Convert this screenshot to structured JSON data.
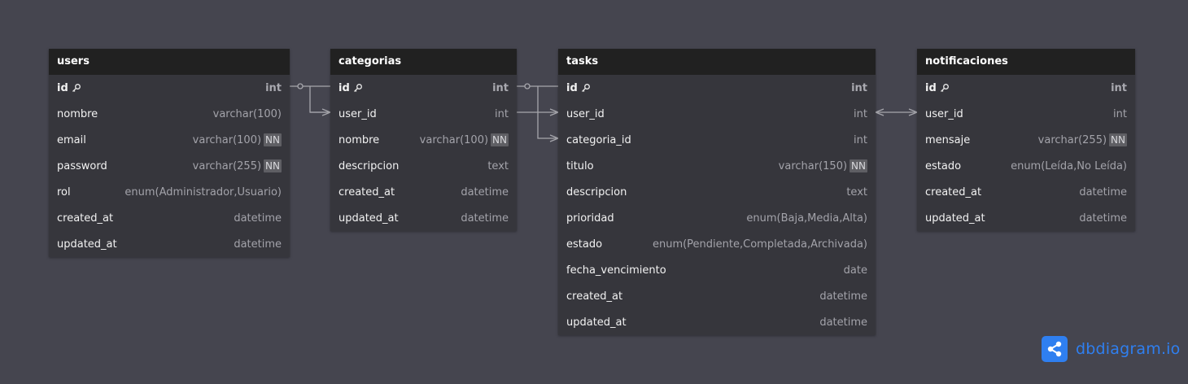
{
  "colors": {
    "background": "#45454f",
    "table_header": "#212121",
    "table_body": "#36363c",
    "connector": "#a6a6ac",
    "brand": "#2f7ff0"
  },
  "tables": [
    {
      "name": "users",
      "fields": [
        {
          "name": "id",
          "type": "int",
          "pk": true,
          "nn": false
        },
        {
          "name": "nombre",
          "type": "varchar(100)",
          "pk": false,
          "nn": false
        },
        {
          "name": "email",
          "type": "varchar(100)",
          "pk": false,
          "nn": true
        },
        {
          "name": "password",
          "type": "varchar(255)",
          "pk": false,
          "nn": true
        },
        {
          "name": "rol",
          "type": "enum(Administrador,Usuario)",
          "pk": false,
          "nn": false
        },
        {
          "name": "created_at",
          "type": "datetime",
          "pk": false,
          "nn": false
        },
        {
          "name": "updated_at",
          "type": "datetime",
          "pk": false,
          "nn": false
        }
      ]
    },
    {
      "name": "categorias",
      "fields": [
        {
          "name": "id",
          "type": "int",
          "pk": true,
          "nn": false
        },
        {
          "name": "user_id",
          "type": "int",
          "pk": false,
          "nn": false
        },
        {
          "name": "nombre",
          "type": "varchar(100)",
          "pk": false,
          "nn": true
        },
        {
          "name": "descripcion",
          "type": "text",
          "pk": false,
          "nn": false
        },
        {
          "name": "created_at",
          "type": "datetime",
          "pk": false,
          "nn": false
        },
        {
          "name": "updated_at",
          "type": "datetime",
          "pk": false,
          "nn": false
        }
      ]
    },
    {
      "name": "tasks",
      "fields": [
        {
          "name": "id",
          "type": "int",
          "pk": true,
          "nn": false
        },
        {
          "name": "user_id",
          "type": "int",
          "pk": false,
          "nn": false
        },
        {
          "name": "categoria_id",
          "type": "int",
          "pk": false,
          "nn": false
        },
        {
          "name": "titulo",
          "type": "varchar(150)",
          "pk": false,
          "nn": true
        },
        {
          "name": "descripcion",
          "type": "text",
          "pk": false,
          "nn": false
        },
        {
          "name": "prioridad",
          "type": "enum(Baja,Media,Alta)",
          "pk": false,
          "nn": false
        },
        {
          "name": "estado",
          "type": "enum(Pendiente,Completada,Archivada)",
          "pk": false,
          "nn": false
        },
        {
          "name": "fecha_vencimiento",
          "type": "date",
          "pk": false,
          "nn": false
        },
        {
          "name": "created_at",
          "type": "datetime",
          "pk": false,
          "nn": false
        },
        {
          "name": "updated_at",
          "type": "datetime",
          "pk": false,
          "nn": false
        }
      ]
    },
    {
      "name": "notificaciones",
      "fields": [
        {
          "name": "id",
          "type": "int",
          "pk": true,
          "nn": false
        },
        {
          "name": "user_id",
          "type": "int",
          "pk": false,
          "nn": false
        },
        {
          "name": "mensaje",
          "type": "varchar(255)",
          "pk": false,
          "nn": true
        },
        {
          "name": "estado",
          "type": "enum(Leída,No Leída)",
          "pk": false,
          "nn": false
        },
        {
          "name": "created_at",
          "type": "datetime",
          "pk": false,
          "nn": false
        },
        {
          "name": "updated_at",
          "type": "datetime",
          "pk": false,
          "nn": false
        }
      ]
    }
  ],
  "nn_label": "NN",
  "relationships": [
    {
      "from": "users.id",
      "to": "categorias.user_id",
      "type": "one-to-many"
    },
    {
      "from": "users.id",
      "to": "tasks.user_id",
      "type": "one-to-many"
    },
    {
      "from": "categorias.id",
      "to": "tasks.categoria_id",
      "type": "one-to-many"
    },
    {
      "from": "tasks.user_id",
      "to": "notificaciones.user_id",
      "type": "many-to-many"
    }
  ],
  "brand": {
    "name": "dbdiagram",
    "suffix": ".io",
    "icon": "share-icon"
  }
}
